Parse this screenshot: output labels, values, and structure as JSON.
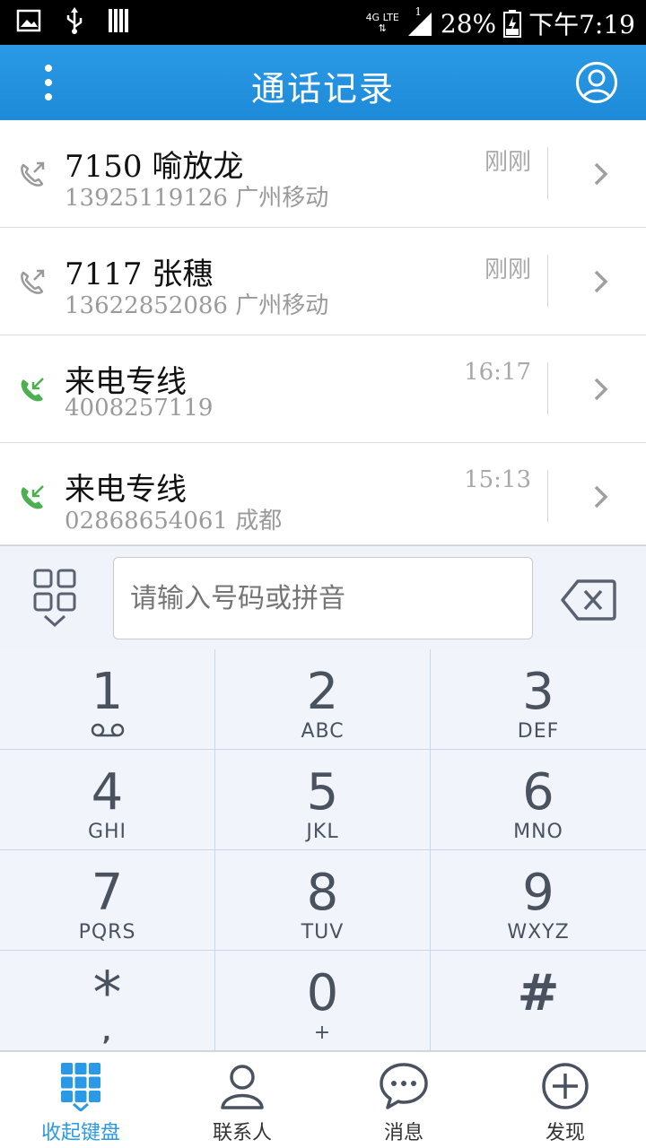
{
  "status_bar": {
    "network": "4G LTE",
    "signal": "1",
    "battery": "28%",
    "time": "下午7:19"
  },
  "app_bar": {
    "title": "通话记录"
  },
  "calls": [
    {
      "name": "7150 喻放龙",
      "number": "13925119126 广州移动",
      "time": "刚刚",
      "type": "outgoing"
    },
    {
      "name": "7117 张穗",
      "number": "13622852086 广州移动",
      "time": "刚刚",
      "type": "outgoing"
    },
    {
      "name": "来电专线",
      "number": "4008257119",
      "time": "16:17",
      "type": "incoming"
    },
    {
      "name": "来电专线",
      "number": "02868654061 成都",
      "time": "15:13",
      "type": "incoming"
    }
  ],
  "dial_input": {
    "placeholder": "请输入号码或拼音",
    "value": ""
  },
  "keys": [
    {
      "digit": "1",
      "letters": "voicemail"
    },
    {
      "digit": "2",
      "letters": "ABC"
    },
    {
      "digit": "3",
      "letters": "DEF"
    },
    {
      "digit": "4",
      "letters": "GHI"
    },
    {
      "digit": "5",
      "letters": "JKL"
    },
    {
      "digit": "6",
      "letters": "MNO"
    },
    {
      "digit": "7",
      "letters": "PQRS"
    },
    {
      "digit": "8",
      "letters": "TUV"
    },
    {
      "digit": "9",
      "letters": "WXYZ"
    },
    {
      "digit": "*",
      "letters": ","
    },
    {
      "digit": "0",
      "letters": "+"
    },
    {
      "digit": "#",
      "letters": ""
    }
  ],
  "bottom_nav": [
    {
      "label": "收起键盘",
      "icon": "keypad-grid-icon",
      "active": true
    },
    {
      "label": "联系人",
      "icon": "contacts-icon",
      "active": false
    },
    {
      "label": "消息",
      "icon": "message-icon",
      "active": false
    },
    {
      "label": "发现",
      "icon": "discover-icon",
      "active": false
    }
  ],
  "colors": {
    "accent": "#2a9ae6",
    "incoming": "#4caf50",
    "outgoing": "#9a9a9a"
  }
}
